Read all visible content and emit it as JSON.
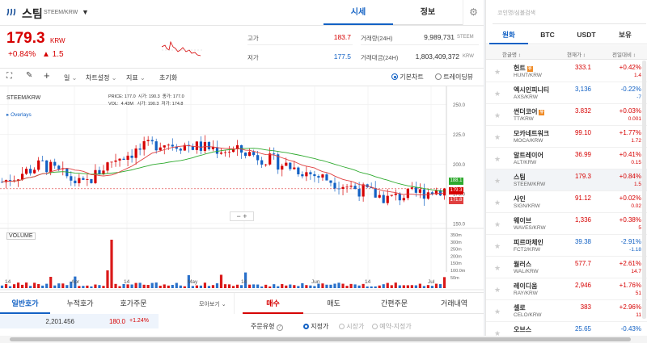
{
  "header": {
    "coin_name": "스팀",
    "pair": "STEEM/KRW",
    "tab_quote": "시세",
    "tab_info": "정보"
  },
  "price": {
    "value": "179.3",
    "unit": "KRW",
    "change_pct": "+0.84%",
    "change_abs": "▲ 1.5"
  },
  "stats": {
    "high_label": "고가",
    "high": "183.7",
    "low_label": "저가",
    "low": "177.5",
    "vol_label": "거래량(24H)",
    "vol": "9,989,731",
    "vol_unit": "STEEM",
    "amt_label": "거래대금(24H)",
    "amt": "1,803,409,372",
    "amt_unit": "KRW"
  },
  "toolbar": {
    "interval": "일",
    "chart_settings": "차트설정",
    "indicators": "지표",
    "reset": "초기화",
    "basic_chart": "기본차트",
    "trading_view": "트레이딩뷰"
  },
  "chart": {
    "symbol": "STEEM/KRW",
    "overlays": "Overlays",
    "price_label": "PRICE:",
    "price_val": "177.0",
    "open_label": "시가:",
    "open_val": "190.3",
    "close_label": "종가:",
    "close_val": "177.0",
    "vol_label": "VOL:",
    "vol_val": "4.43M",
    "open2_label": "시가:",
    "open2_val": "190.3",
    "low_label": "저가:",
    "low_val": "174.8",
    "volume_title": "VOLUME",
    "y_ticks": [
      "250.0",
      "225.0",
      "200.0",
      "175.0",
      "150.0"
    ],
    "vol_ticks": [
      "350m",
      "300m",
      "250m",
      "200m",
      "150m",
      "100.0m",
      "50m"
    ],
    "x_ticks": [
      "14",
      "Apr",
      "14",
      "May",
      "14",
      "Jun",
      "14",
      "Jul"
    ],
    "price_tags": [
      "188.1",
      "179.3",
      "171.8"
    ],
    "colors": {
      "up": "#d60000",
      "down": "#1261c4",
      "ma_green": "#2eaa2e",
      "ma_red": "#e04040"
    }
  },
  "bottom": {
    "tab_general": "일반호가",
    "tab_cumulative": "누적호가",
    "tab_order_quote": "호가주문",
    "view_more": "모아보기",
    "tab_buy": "매수",
    "tab_sell": "매도",
    "tab_simple": "간편주문",
    "tab_history": "거래내역",
    "order_amount": "2,201.456",
    "order_price": "180.0",
    "order_pct": "+1.24%",
    "order_type_label": "주문유형",
    "opt_limit": "지정가",
    "opt_market": "시장가",
    "opt_reserved": "예약-지정가"
  },
  "market": {
    "search_placeholder": "코인명/심볼검색",
    "tabs": [
      "원화",
      "BTC",
      "USDT",
      "보유"
    ],
    "col_name": "한글명",
    "col_price": "현재가",
    "col_change": "전일대비",
    "coins": [
      {
        "name": "헌트",
        "code": "HUNT/KRW",
        "price": "333.1",
        "pct": "+0.42%",
        "abs": "1.4",
        "dir": "up",
        "badge": true
      },
      {
        "name": "엑시인피니티",
        "code": "AXS/KRW",
        "price": "3,136",
        "pct": "-0.22%",
        "abs": "-7",
        "dir": "down",
        "badge": false
      },
      {
        "name": "썬더코어",
        "code": "TT/KRW",
        "price": "3.832",
        "pct": "+0.03%",
        "abs": "0.001",
        "dir": "up",
        "badge": true
      },
      {
        "name": "모카네트워크",
        "code": "MOCA/KRW",
        "price": "99.10",
        "pct": "+1.77%",
        "abs": "1.72",
        "dir": "up",
        "badge": false
      },
      {
        "name": "알트레이어",
        "code": "ALT/KRW",
        "price": "36.99",
        "pct": "+0.41%",
        "abs": "0.15",
        "dir": "up",
        "badge": false
      },
      {
        "name": "스팀",
        "code": "STEEM/KRW",
        "price": "179.3",
        "pct": "+0.84%",
        "abs": "1.5",
        "dir": "up",
        "badge": false
      },
      {
        "name": "사인",
        "code": "SIGN/KRW",
        "price": "91.12",
        "pct": "+0.02%",
        "abs": "0.02",
        "dir": "up",
        "badge": false
      },
      {
        "name": "웨이브",
        "code": "WAVES/KRW",
        "price": "1,336",
        "pct": "+0.38%",
        "abs": "5",
        "dir": "up",
        "badge": false
      },
      {
        "name": "피르마체인",
        "code": "FCT2/KRW",
        "price": "39.38",
        "pct": "-2.91%",
        "abs": "-1.18",
        "dir": "down",
        "badge": false
      },
      {
        "name": "월러스",
        "code": "WAL/KRW",
        "price": "577.7",
        "pct": "+2.61%",
        "abs": "14.7",
        "dir": "up",
        "badge": false
      },
      {
        "name": "레이디움",
        "code": "RAY/KRW",
        "price": "2,946",
        "pct": "+1.76%",
        "abs": "51",
        "dir": "up",
        "badge": false
      },
      {
        "name": "셀로",
        "code": "CELO/KRW",
        "price": "383",
        "pct": "+2.96%",
        "abs": "11",
        "dir": "up",
        "badge": false
      },
      {
        "name": "오브스",
        "code": "",
        "price": "25.65",
        "pct": "-0.43%",
        "abs": "",
        "dir": "down",
        "badge": false
      }
    ]
  }
}
